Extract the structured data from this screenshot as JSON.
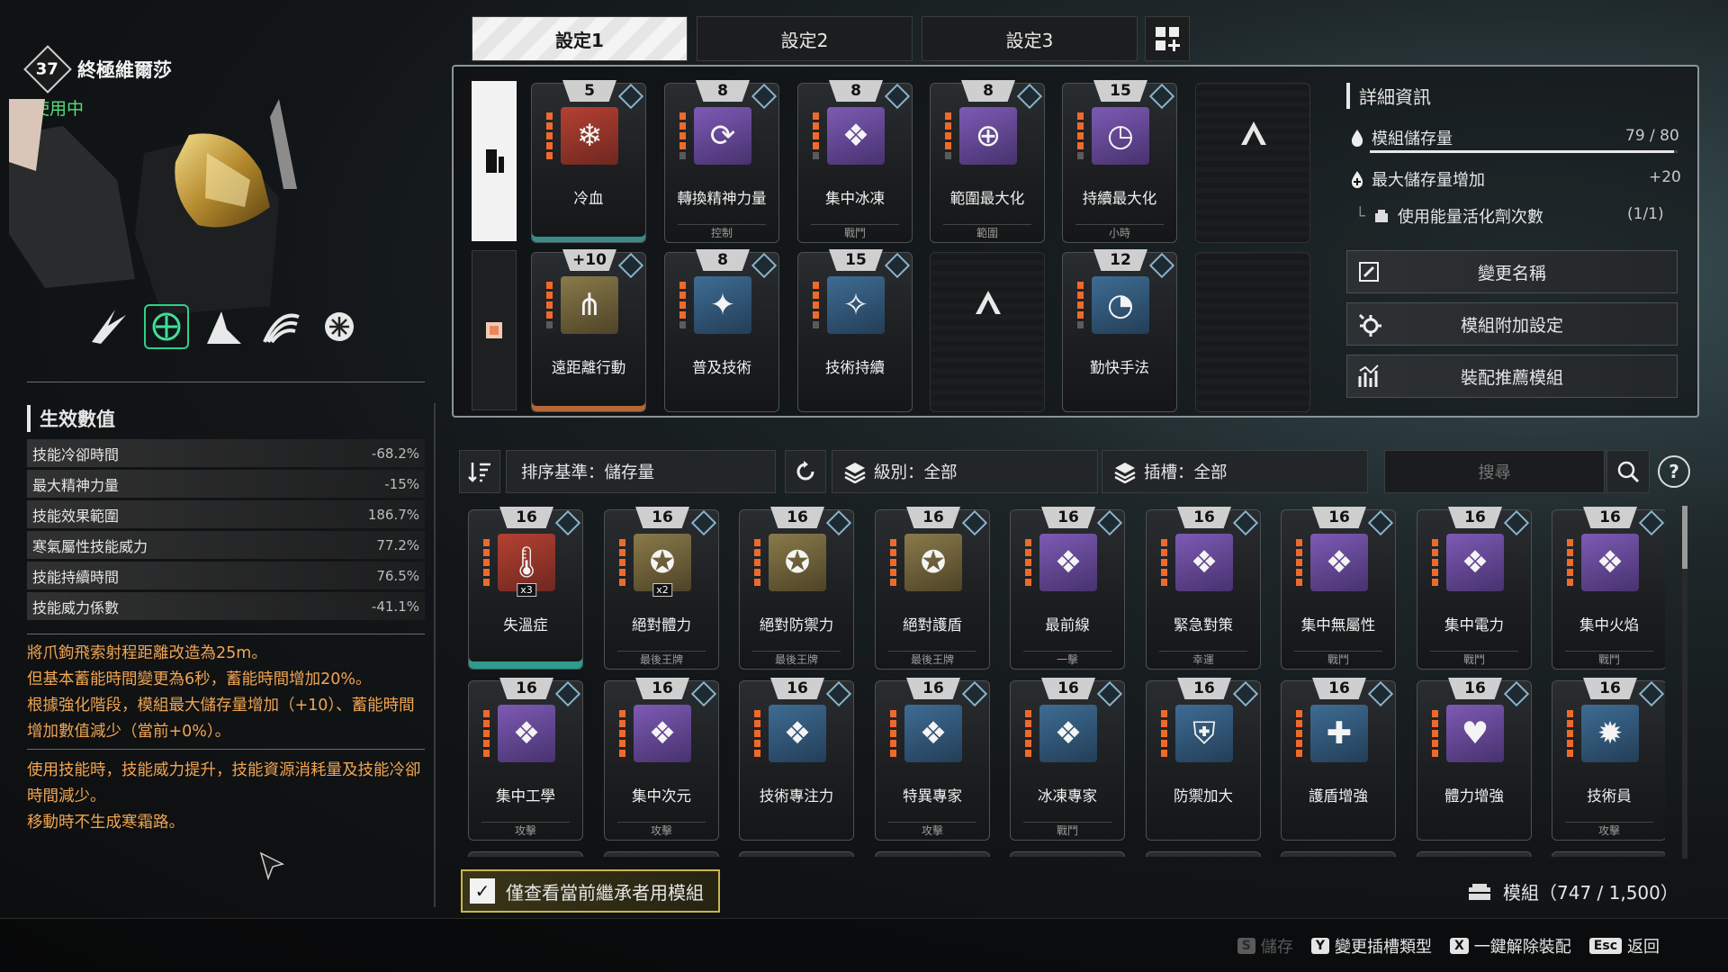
{
  "character": {
    "level": "37",
    "name": "終極維爾莎",
    "status": "使用中"
  },
  "stats": {
    "title": "生效數值",
    "rows": [
      {
        "label": "技能冷卻時間",
        "value": "-68.2%"
      },
      {
        "label": "最大精神力量",
        "value": "-15%"
      },
      {
        "label": "技能效果範圍",
        "value": "186.7%"
      },
      {
        "label": "寒氣屬性技能威力",
        "value": "77.2%"
      },
      {
        "label": "技能持續時間",
        "value": "76.5%"
      },
      {
        "label": "技能威力係數",
        "value": "-41.1%"
      }
    ]
  },
  "descriptions": {
    "p1": "將爪鉤飛索射程距離改造為25m。\n但基本蓄能時間變更為6秒，蓄能時間增加20%。\n根據強化階段，模組最大儲存量增加（+10）、蓄能時間增加數值減少（當前+0%）。",
    "p2": "使用技能時，技能威力提升，技能資源消耗量及技能冷卻時間減少。\n移動時不生成寒霜路。"
  },
  "tabs": [
    "設定1",
    "設定2",
    "設定3"
  ],
  "equipped": {
    "row1": [
      {
        "cap": "5",
        "name": "冷血",
        "tag": "",
        "color": "red",
        "glyph": "❄",
        "pips": 5
      },
      {
        "cap": "8",
        "name": "轉換精神力量",
        "tag": "控制",
        "color": "purple",
        "glyph": "⟳",
        "pips": 4
      },
      {
        "cap": "8",
        "name": "集中冰凍",
        "tag": "戰鬥",
        "color": "purple",
        "glyph": "❖",
        "pips": 4
      },
      {
        "cap": "8",
        "name": "範圍最大化",
        "tag": "範圍",
        "color": "purple",
        "glyph": "⊕",
        "pips": 4
      },
      {
        "cap": "15",
        "name": "持續最大化",
        "tag": "小時",
        "color": "purple",
        "glyph": "◷",
        "pips": 4
      }
    ],
    "row2": [
      {
        "cap": "+10",
        "name": "遠距離行動",
        "tag": "",
        "color": "gold",
        "glyph": "⋔",
        "pips": 4
      },
      {
        "cap": "8",
        "name": "普及技術",
        "tag": "",
        "color": "blue",
        "glyph": "✦",
        "pips": 4
      },
      {
        "cap": "15",
        "name": "技術持續",
        "tag": "",
        "color": "blue",
        "glyph": "✧",
        "pips": 4
      },
      {
        "cap": "12",
        "name": "勤快手法",
        "tag": "",
        "color": "blue",
        "glyph": "◔",
        "pips": 4
      }
    ]
  },
  "detail": {
    "title": "詳細資訊",
    "capacity_label": "模組儲存量",
    "capacity_value": "79 / 80",
    "capacity_fraction": 0.9875,
    "max_label": "最大儲存量增加",
    "max_value": "+20",
    "activator_label": "使用能量活化劑次數",
    "activator_value": "(1/1)",
    "buttons": [
      "變更名稱",
      "模組附加設定",
      "裝配推薦模組"
    ]
  },
  "filters": {
    "sort": "排序基準：儲存量",
    "grade": "級別：全部",
    "socket": "插槽：全部",
    "search_placeholder": "搜尋"
  },
  "inventory": {
    "row1": [
      {
        "cap": "16",
        "name": "失溫症",
        "tag": "",
        "color": "red",
        "glyph": "🌡",
        "mult": "x3",
        "selected": true
      },
      {
        "cap": "16",
        "name": "絕對體力",
        "tag": "最後王牌",
        "color": "gold",
        "glyph": "✪",
        "mult": "x2"
      },
      {
        "cap": "16",
        "name": "絕對防禦力",
        "tag": "最後王牌",
        "color": "gold",
        "glyph": "✪",
        "mult": ""
      },
      {
        "cap": "16",
        "name": "絕對護盾",
        "tag": "最後王牌",
        "color": "gold",
        "glyph": "✪",
        "mult": ""
      },
      {
        "cap": "16",
        "name": "最前線",
        "tag": "一擊",
        "color": "purple",
        "glyph": "❖",
        "mult": ""
      },
      {
        "cap": "16",
        "name": "緊急對策",
        "tag": "幸運",
        "color": "purple",
        "glyph": "❖",
        "mult": ""
      },
      {
        "cap": "16",
        "name": "集中無屬性",
        "tag": "戰鬥",
        "color": "purple",
        "glyph": "❖",
        "mult": ""
      },
      {
        "cap": "16",
        "name": "集中電力",
        "tag": "戰鬥",
        "color": "purple",
        "glyph": "❖",
        "mult": ""
      },
      {
        "cap": "16",
        "name": "集中火焰",
        "tag": "戰鬥",
        "color": "purple",
        "glyph": "❖",
        "mult": ""
      }
    ],
    "row2": [
      {
        "cap": "16",
        "name": "集中工學",
        "tag": "攻擊",
        "color": "purple",
        "glyph": "❖"
      },
      {
        "cap": "16",
        "name": "集中次元",
        "tag": "攻擊",
        "color": "purple",
        "glyph": "❖"
      },
      {
        "cap": "16",
        "name": "技術專注力",
        "tag": "",
        "color": "blue",
        "glyph": "❖"
      },
      {
        "cap": "16",
        "name": "特異專家",
        "tag": "攻擊",
        "color": "blue",
        "glyph": "❖"
      },
      {
        "cap": "16",
        "name": "冰凍專家",
        "tag": "戰鬥",
        "color": "blue",
        "glyph": "❖"
      },
      {
        "cap": "16",
        "name": "防禦加大",
        "tag": "",
        "color": "blue",
        "glyph": "⛨"
      },
      {
        "cap": "16",
        "name": "護盾增強",
        "tag": "",
        "color": "blue",
        "glyph": "✚"
      },
      {
        "cap": "16",
        "name": "體力增強",
        "tag": "",
        "color": "purple",
        "glyph": "♥"
      },
      {
        "cap": "16",
        "name": "技術員",
        "tag": "攻擊",
        "color": "blue",
        "glyph": "✹"
      }
    ]
  },
  "footer": {
    "inherit_only": "僅查看當前繼承者用模組",
    "module_count": "模組（747 / 1,500）",
    "hints": [
      {
        "key": "S",
        "label": "儲存",
        "disabled": true
      },
      {
        "key": "Y",
        "label": "變更插槽類型",
        "disabled": false
      },
      {
        "key": "X",
        "label": "一鍵解除裝配",
        "disabled": false
      },
      {
        "key": "Esc",
        "label": "返回",
        "disabled": false
      }
    ]
  },
  "colors": {
    "status_green": "#52e07a",
    "desc_orange": "#f0a552",
    "pip_orange": "#ee6a2c",
    "highlight_teal": "#2e9b8e",
    "inherit_gold": "#c9b64a"
  }
}
